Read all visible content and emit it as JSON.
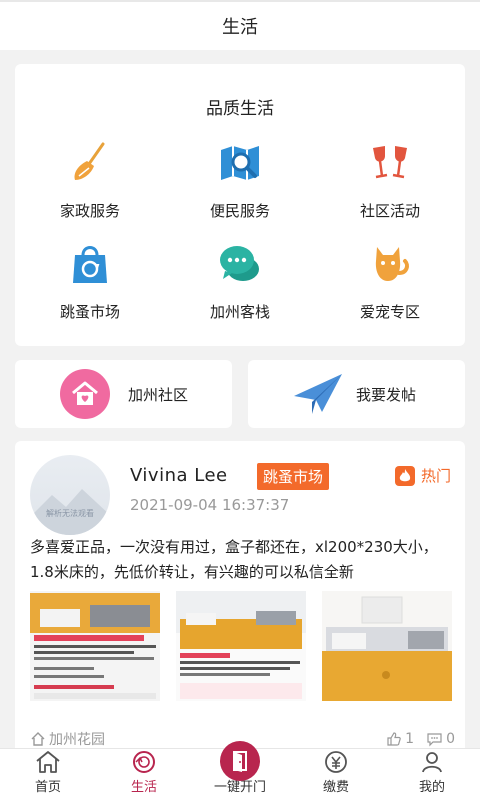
{
  "header": {
    "title": "生活"
  },
  "quality": {
    "title": "品质生活",
    "items": [
      {
        "label": "家政服务",
        "icon": "broom-icon"
      },
      {
        "label": "便民服务",
        "icon": "map-search-icon"
      },
      {
        "label": "社区活动",
        "icon": "wine-glasses-icon"
      },
      {
        "label": "跳蚤市场",
        "icon": "shopping-bag-icon"
      },
      {
        "label": "加州客栈",
        "icon": "chat-bubbles-icon"
      },
      {
        "label": "爱宠专区",
        "icon": "cat-icon"
      }
    ]
  },
  "shortcuts": {
    "community": "加州社区",
    "post": "我要发帖"
  },
  "post": {
    "avatar_watermark": "解析无法观看",
    "username": "Vivina Lee",
    "time": "2021-09-04 16:37:37",
    "tag": "跳蚤市场",
    "hot": "热门",
    "text": "多喜爱正品，一次没有用过，盒子都还在，xl200*230大小，1.8米床的，先低价转让，有兴趣的可以私信全新",
    "location": "加州花园",
    "likes": "1",
    "comments": "0"
  },
  "tabs": [
    {
      "label": "首页",
      "icon": "home-icon"
    },
    {
      "label": "生活",
      "icon": "record-disc-icon"
    },
    {
      "label": "一键开门",
      "icon": "door-icon"
    },
    {
      "label": "缴费",
      "icon": "payment-icon"
    },
    {
      "label": "我的",
      "icon": "user-icon"
    }
  ],
  "colors": {
    "accent": "#b8254e",
    "tag": "#f36a2b",
    "icon_blue": "#2f8fd6",
    "icon_teal": "#2bb3a3",
    "icon_orange": "#f0a23c",
    "icon_red": "#e2553e"
  }
}
